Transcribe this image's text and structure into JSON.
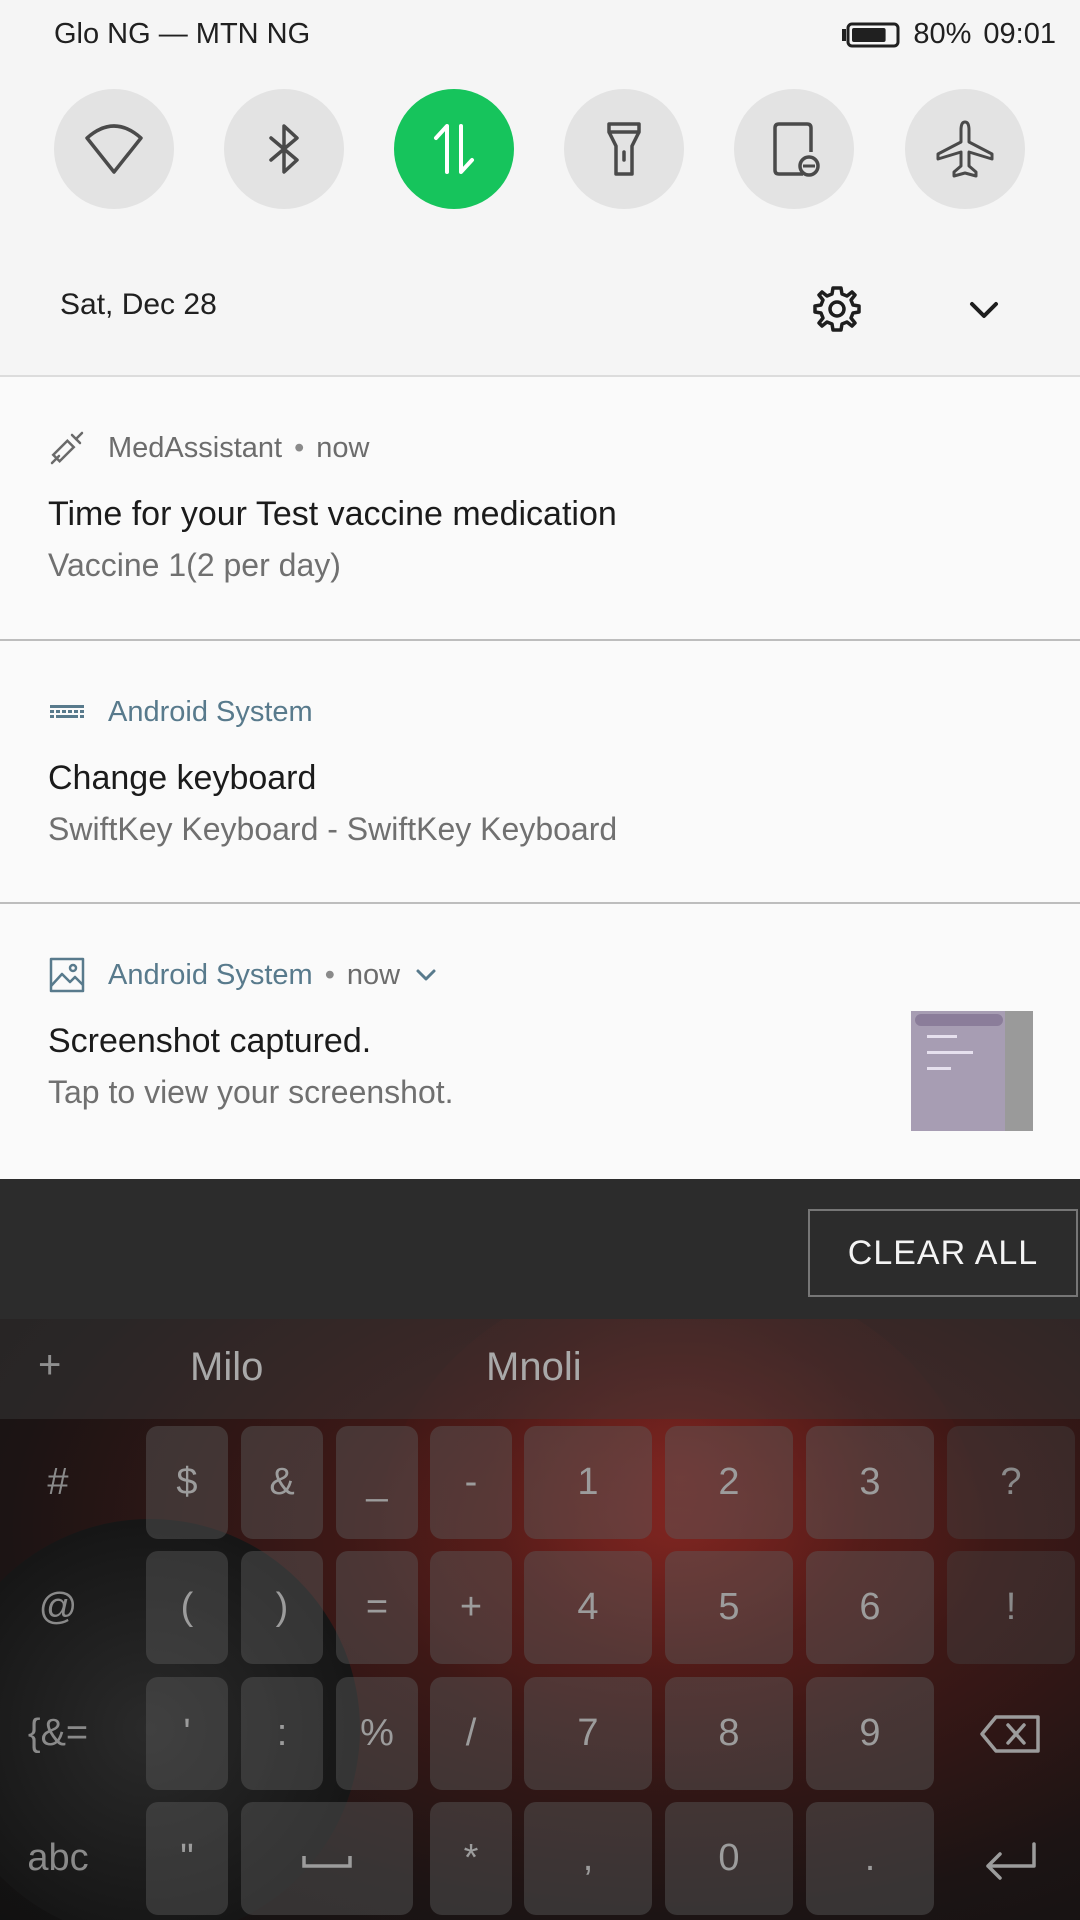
{
  "status_bar": {
    "carrier": "Glo NG — MTN NG",
    "battery_percent": "80%",
    "time": "09:01",
    "battery_level": 0.8
  },
  "quick_settings": {
    "tiles": [
      {
        "icon": "wifi-icon",
        "active": false
      },
      {
        "icon": "bluetooth-icon",
        "active": false
      },
      {
        "icon": "mobile-data-icon",
        "active": true,
        "color": "#16c45c"
      },
      {
        "icon": "flashlight-icon",
        "active": false
      },
      {
        "icon": "rotation-lock-icon",
        "active": false
      },
      {
        "icon": "airplane-mode-icon",
        "active": false
      }
    ],
    "date": "Sat, Dec 28",
    "settings_icon": "gear-icon",
    "expand_icon": "chevron-down-icon"
  },
  "notifications": [
    {
      "app": "MedAssistant",
      "time": "now",
      "icon": "syringe-icon",
      "title": "Time for your Test vaccine medication",
      "text": "Vaccine 1(2 per day)"
    },
    {
      "app": "Android System",
      "icon": "keyboard-icon",
      "title": "Change keyboard",
      "text": "SwiftKey Keyboard - SwiftKey Keyboard"
    },
    {
      "app": "Android System",
      "time": "now",
      "icon": "image-icon",
      "title": "Screenshot captured.",
      "text": "Tap to view your screenshot."
    }
  ],
  "clear_all": "CLEAR ALL",
  "keyboard": {
    "suggestions": [
      "+",
      "Milo",
      "Mnoli"
    ],
    "rows": [
      [
        "#",
        "$",
        "&",
        "_",
        "-",
        "1",
        "2",
        "3",
        "?"
      ],
      [
        "@",
        "(",
        ")",
        "=",
        "+",
        "4",
        "5",
        "6",
        "!"
      ],
      [
        "{&=",
        "'",
        ":",
        "%",
        "/",
        "7",
        "8",
        "9",
        "backspace"
      ],
      [
        "abc",
        "\"",
        "space",
        "*",
        ",",
        "0",
        ".",
        "enter"
      ]
    ]
  },
  "colors": {
    "accent_green": "#16c45c",
    "app_name_blue": "#587a8c"
  }
}
